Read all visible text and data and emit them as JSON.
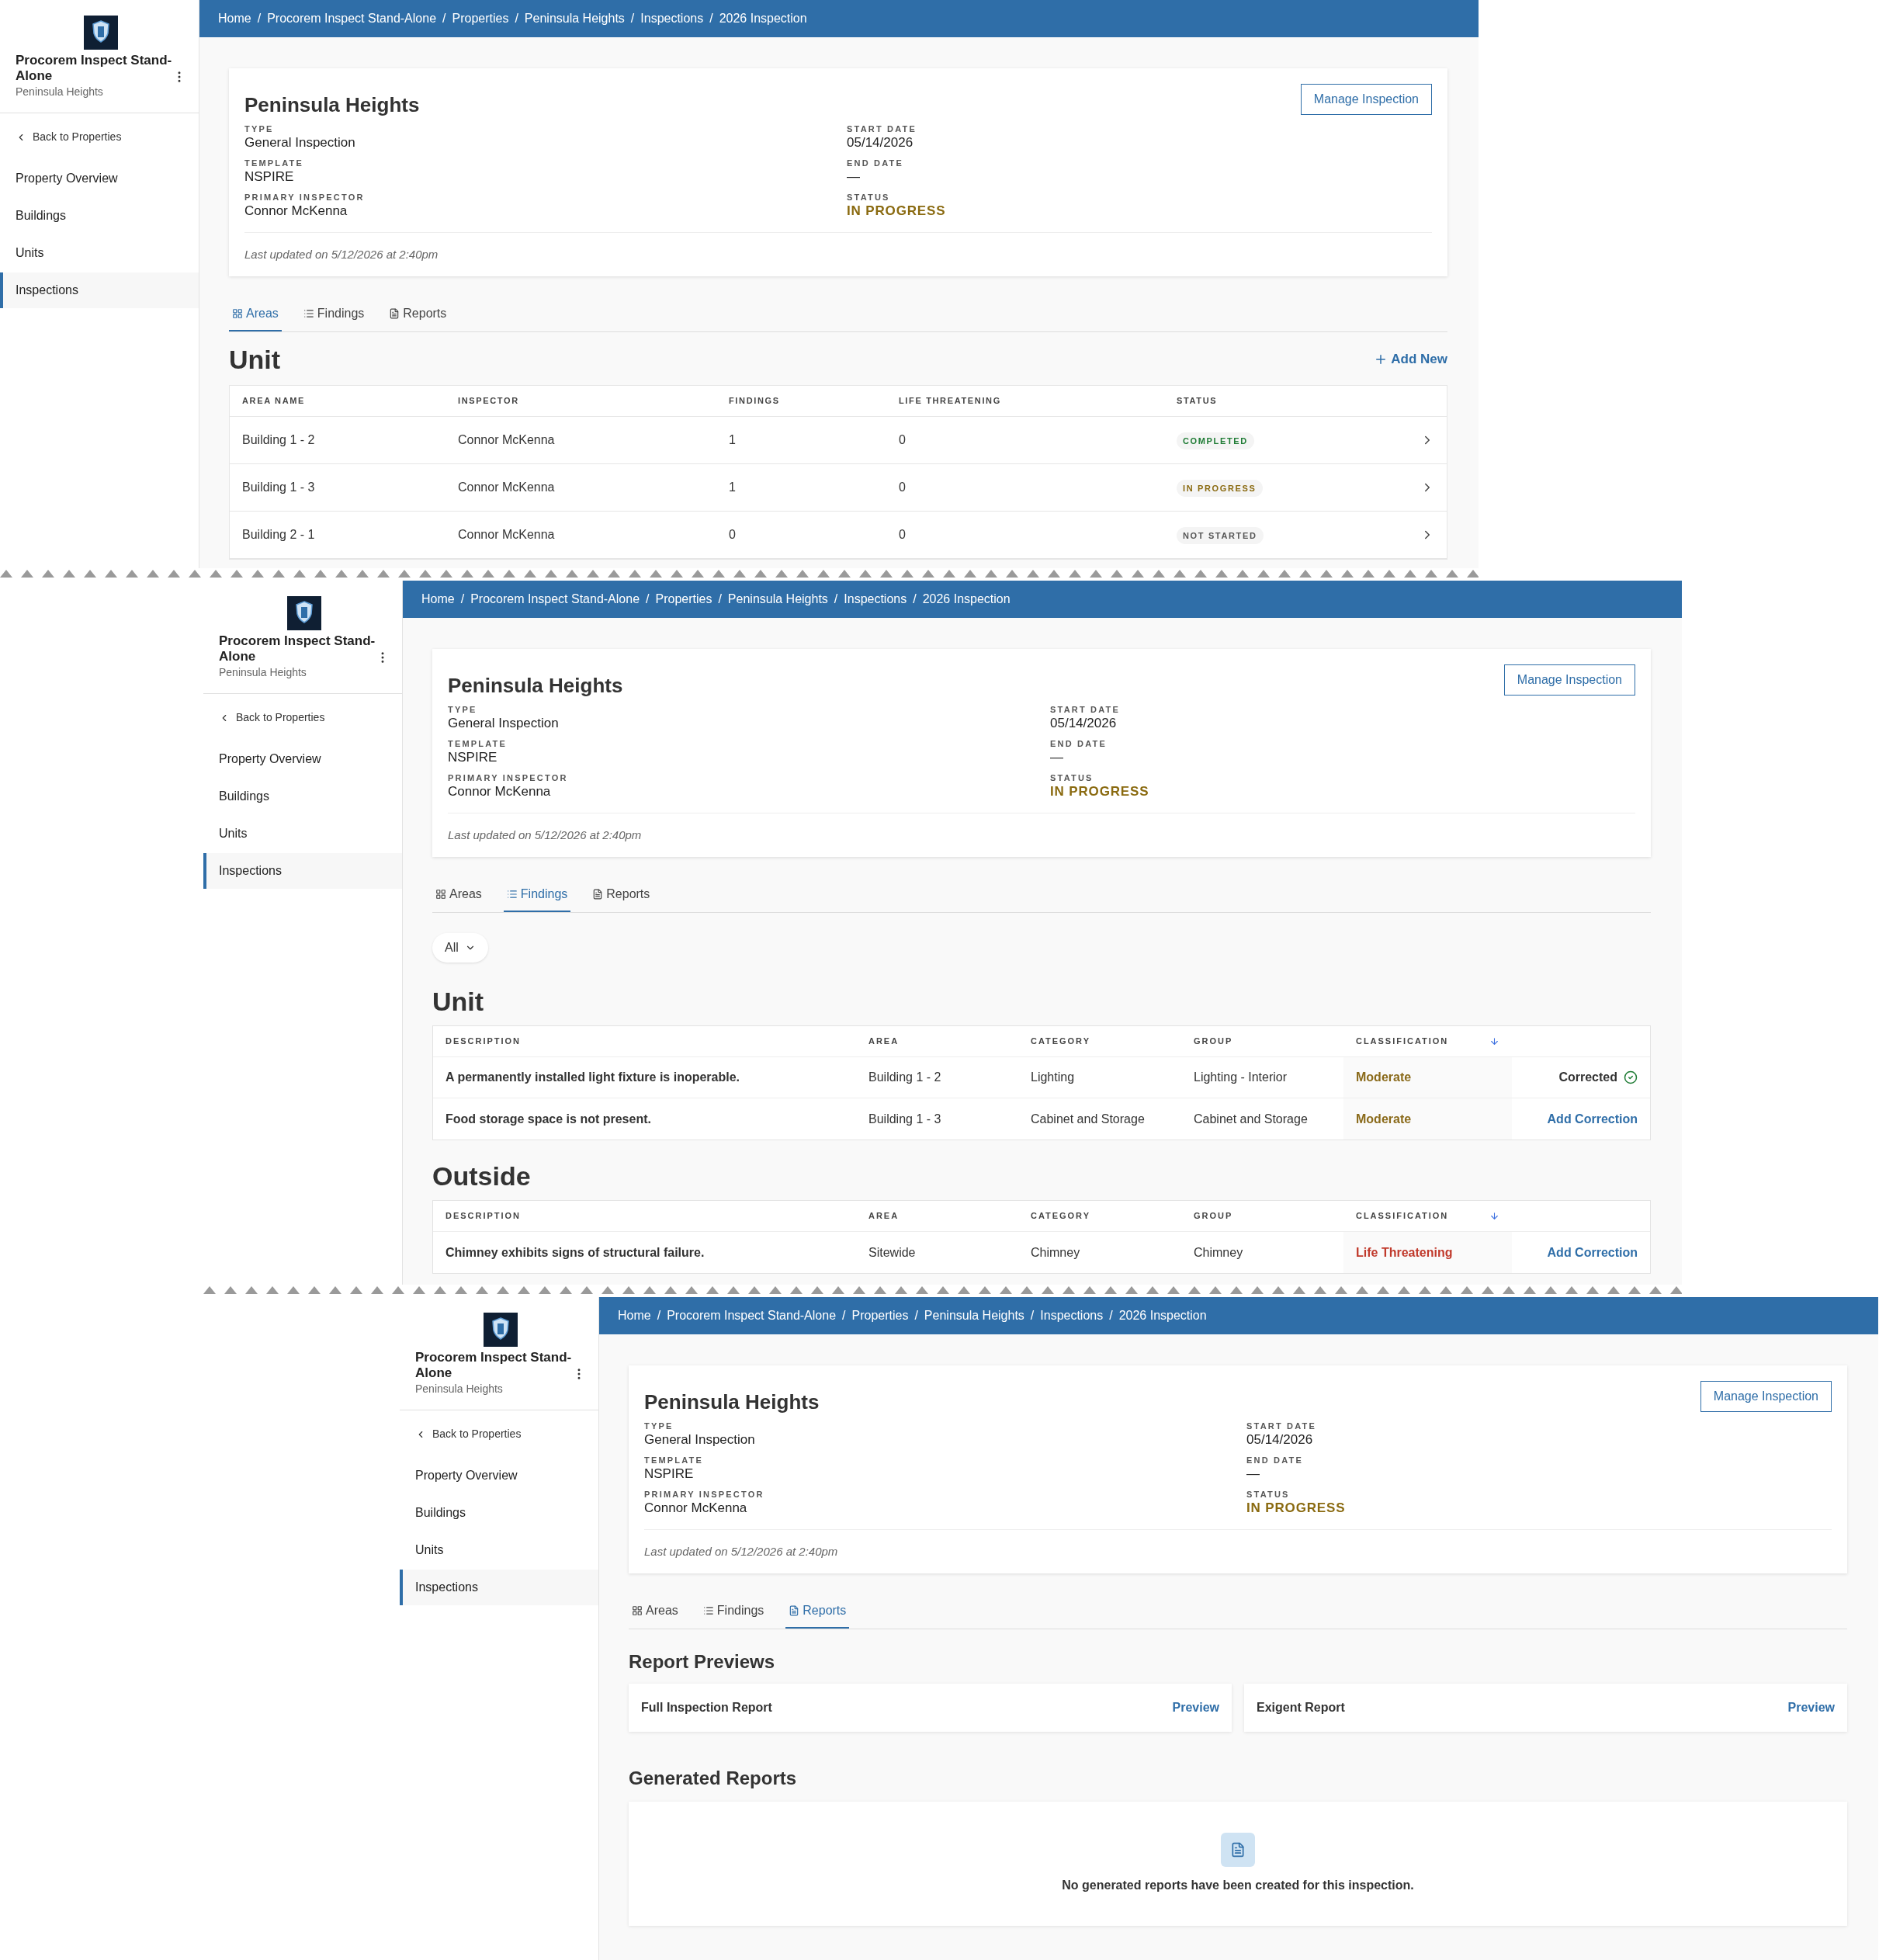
{
  "screens": [
    {
      "kind": "areas",
      "breadcrumb_separator": "/",
      "breadcrumb": [
        "Home",
        "Procorem Inspect Stand-Alone",
        "Properties",
        "Peninsula Heights",
        "Inspections",
        "2026 Inspection"
      ],
      "sidebar": {
        "title": "Procorem Inspect Stand-Alone",
        "subtitle": "Peninsula Heights",
        "back_link": "Back to Properties",
        "items": [
          {
            "label": "Property Overview",
            "selected": false
          },
          {
            "label": "Buildings",
            "selected": false
          },
          {
            "label": "Units",
            "selected": false
          },
          {
            "label": "Inspections",
            "selected": true
          }
        ]
      },
      "inspection": {
        "title": "Peninsula Heights",
        "button": "Manage Inspection",
        "fields": [
          {
            "label": "TYPE",
            "value": "General Inspection",
            "kind": "text"
          },
          {
            "label": "START DATE",
            "value": "05/14/2026",
            "kind": "text"
          },
          {
            "label": "TEMPLATE",
            "value": "NSPIRE",
            "kind": "text"
          },
          {
            "label": "END DATE",
            "value": "—",
            "kind": "text"
          },
          {
            "label": "PRIMARY INSPECTOR",
            "value": "Connor McKenna",
            "kind": "text"
          },
          {
            "label": "STATUS",
            "value": "IN PROGRESS",
            "kind": "status"
          }
        ],
        "last_updated": "Last updated on 5/12/2026 at 2:40pm"
      },
      "tabs": [
        {
          "label": "Areas",
          "selected": true
        },
        {
          "label": "Findings",
          "selected": false
        },
        {
          "label": "Reports",
          "selected": false
        }
      ],
      "areas": {
        "heading": "Unit",
        "add_button": "Add New",
        "columns": [
          "AREA NAME",
          "INSPECTOR",
          "FINDINGS",
          "LIFE THREATENING",
          "STATUS"
        ],
        "rows": [
          {
            "cells": [
              "Building 1 - 2",
              "Connor McKenna",
              "1",
              "0"
            ],
            "status": {
              "text": "COMPLETED",
              "color": "#1e7b34"
            }
          },
          {
            "cells": [
              "Building 1 - 3",
              "Connor McKenna",
              "1",
              "0"
            ],
            "status": {
              "text": "IN PROGRESS",
              "color": "#8a6a10"
            }
          },
          {
            "cells": [
              "Building 2 - 1",
              "Connor McKenna",
              "0",
              "0"
            ],
            "status": {
              "text": "NOT STARTED",
              "color": "#555555"
            }
          }
        ]
      }
    },
    {
      "kind": "findings",
      "breadcrumb_separator": "/",
      "breadcrumb": [
        "Home",
        "Procorem Inspect Stand-Alone",
        "Properties",
        "Peninsula Heights",
        "Inspections",
        "2026 Inspection"
      ],
      "sidebar": {
        "title": "Procorem Inspect Stand-Alone",
        "subtitle": "Peninsula Heights",
        "back_link": "Back to Properties",
        "items": [
          {
            "label": "Property Overview",
            "selected": false
          },
          {
            "label": "Buildings",
            "selected": false
          },
          {
            "label": "Units",
            "selected": false
          },
          {
            "label": "Inspections",
            "selected": true
          }
        ]
      },
      "inspection": {
        "title": "Peninsula Heights",
        "button": "Manage Inspection",
        "fields": [
          {
            "label": "TYPE",
            "value": "General Inspection",
            "kind": "text"
          },
          {
            "label": "START DATE",
            "value": "05/14/2026",
            "kind": "text"
          },
          {
            "label": "TEMPLATE",
            "value": "NSPIRE",
            "kind": "text"
          },
          {
            "label": "END DATE",
            "value": "—",
            "kind": "text"
          },
          {
            "label": "PRIMARY INSPECTOR",
            "value": "Connor McKenna",
            "kind": "text"
          },
          {
            "label": "STATUS",
            "value": "IN PROGRESS",
            "kind": "status"
          }
        ],
        "last_updated": "Last updated on 5/12/2026 at 2:40pm"
      },
      "tabs": [
        {
          "label": "Areas",
          "selected": false
        },
        {
          "label": "Findings",
          "selected": true
        },
        {
          "label": "Reports",
          "selected": false
        }
      ],
      "findings": {
        "filter": "All",
        "sections": [
          {
            "heading": "Unit",
            "columns": [
              "DESCRIPTION",
              "AREA",
              "CATEGORY",
              "GROUP",
              "CLASSIFICATION"
            ],
            "rows": [
              {
                "cells": [
                  "A permanently installed light fixture is inoperable.",
                  "Building 1 - 2",
                  "Lighting",
                  "Lighting - Interior"
                ],
                "classification": {
                  "text": "Moderate",
                  "color": "#8a6a1a"
                },
                "action": {
                  "kind": "corrected",
                  "text": "Corrected"
                }
              },
              {
                "cells": [
                  "Food storage space is not present.",
                  "Building 1 - 3",
                  "Cabinet and Storage",
                  "Cabinet and Storage"
                ],
                "classification": {
                  "text": "Moderate",
                  "color": "#8a6a1a"
                },
                "action": {
                  "kind": "link",
                  "text": "Add Correction"
                }
              }
            ]
          },
          {
            "heading": "Outside",
            "columns": [
              "DESCRIPTION",
              "AREA",
              "CATEGORY",
              "GROUP",
              "CLASSIFICATION"
            ],
            "rows": [
              {
                "cells": [
                  "Chimney exhibits signs of structural failure.",
                  "Sitewide",
                  "Chimney",
                  "Chimney"
                ],
                "classification": {
                  "text": "Life Threatening",
                  "color": "#c0392b"
                },
                "action": {
                  "kind": "link",
                  "text": "Add Correction"
                }
              }
            ]
          }
        ]
      }
    },
    {
      "kind": "reports",
      "breadcrumb_separator": "/",
      "breadcrumb": [
        "Home",
        "Procorem Inspect Stand-Alone",
        "Properties",
        "Peninsula Heights",
        "Inspections",
        "2026 Inspection"
      ],
      "sidebar": {
        "title": "Procorem Inspect Stand-Alone",
        "subtitle": "Peninsula Heights",
        "back_link": "Back to Properties",
        "items": [
          {
            "label": "Property Overview",
            "selected": false
          },
          {
            "label": "Buildings",
            "selected": false
          },
          {
            "label": "Units",
            "selected": false
          },
          {
            "label": "Inspections",
            "selected": true
          }
        ]
      },
      "inspection": {
        "title": "Peninsula Heights",
        "button": "Manage Inspection",
        "fields": [
          {
            "label": "TYPE",
            "value": "General Inspection",
            "kind": "text"
          },
          {
            "label": "START DATE",
            "value": "05/14/2026",
            "kind": "text"
          },
          {
            "label": "TEMPLATE",
            "value": "NSPIRE",
            "kind": "text"
          },
          {
            "label": "END DATE",
            "value": "—",
            "kind": "text"
          },
          {
            "label": "PRIMARY INSPECTOR",
            "value": "Connor McKenna",
            "kind": "text"
          },
          {
            "label": "STATUS",
            "value": "IN PROGRESS",
            "kind": "status"
          }
        ],
        "last_updated": "Last updated on 5/12/2026 at 2:40pm"
      },
      "tabs": [
        {
          "label": "Areas",
          "selected": false
        },
        {
          "label": "Findings",
          "selected": false
        },
        {
          "label": "Reports",
          "selected": true
        }
      ],
      "reports": {
        "previews_heading": "Report Previews",
        "previews": [
          {
            "name": "Full Inspection Report",
            "link": "Preview"
          },
          {
            "name": "Exigent Report",
            "link": "Preview"
          }
        ],
        "generated_heading": "Generated Reports",
        "empty_text": "No generated reports have been created for this inspection."
      }
    }
  ]
}
